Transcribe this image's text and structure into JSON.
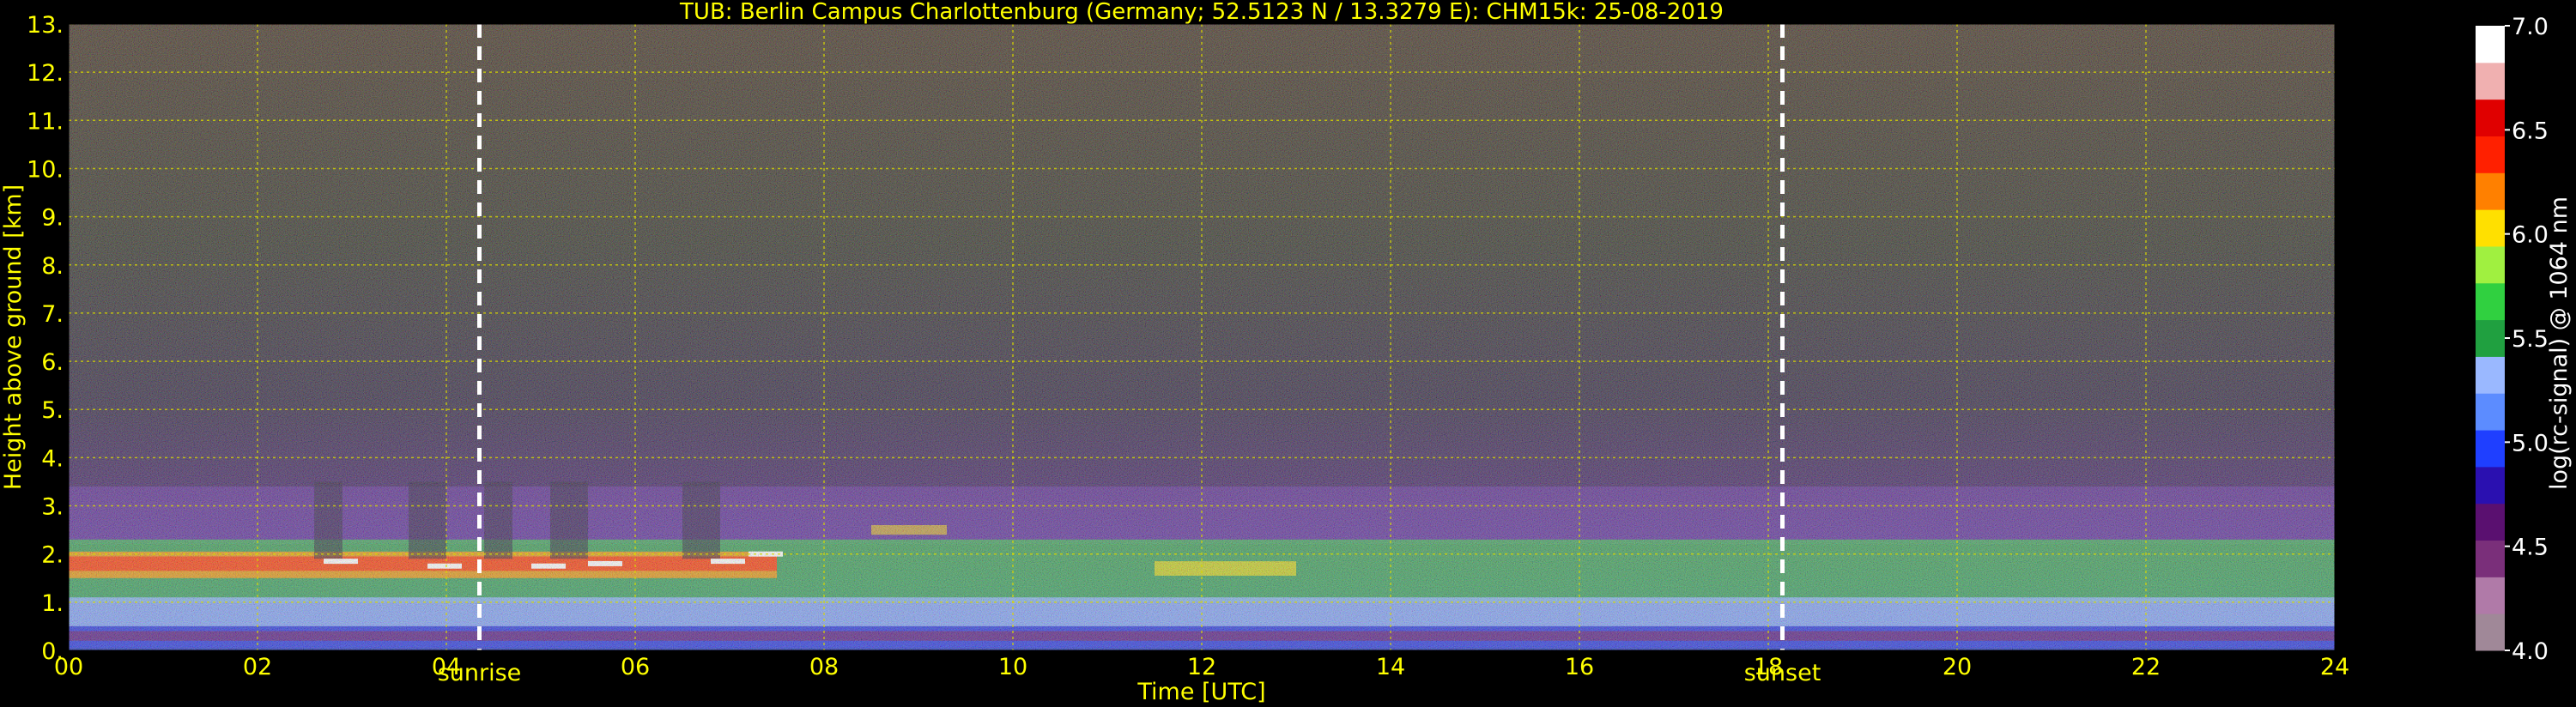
{
  "chart_data": {
    "type": "heatmap",
    "title": "TUB: Berlin Campus Charlottenburg (Germany; 52.5123 N / 13.3279 E):    CHM15k: 25-08-2019",
    "xlabel": "Time [UTC]",
    "ylabel": "Height above ground [km]",
    "xlim": [
      0,
      24
    ],
    "ylim": [
      0,
      13
    ],
    "x_ticks": [
      "00",
      "02",
      "04",
      "06",
      "08",
      "10",
      "12",
      "14",
      "16",
      "18",
      "20",
      "22",
      "24"
    ],
    "y_ticks": [
      "0.",
      "1.",
      "2.",
      "3.",
      "4.",
      "5.",
      "6.",
      "7.",
      "8.",
      "9.",
      "10.",
      "11.",
      "12.",
      "13."
    ],
    "grid": true,
    "colorbar": {
      "label": "log(rc-signal) @ 1064 nm",
      "range": [
        4.0,
        7.0
      ],
      "ticks": [
        "4.0",
        "4.5",
        "5.0",
        "5.5",
        "6.0",
        "6.5",
        "7.0"
      ]
    },
    "events": [
      {
        "name": "sunrise",
        "time_utc": 4.35
      },
      {
        "name": "sunset",
        "time_utc": 18.15
      }
    ],
    "layers": [
      {
        "feature": "mixing-layer top (strong signal)",
        "start": 0,
        "end": 7.5,
        "height_km": 1.8
      },
      {
        "feature": "aerosol layer",
        "start": 7.5,
        "end": 24,
        "height_km": 1.6
      },
      {
        "feature": "near-surface layer",
        "start": 0,
        "end": 24,
        "height_km": 0.4
      }
    ]
  },
  "colors": {
    "text": "#ffff00",
    "grid": "#d8d800",
    "background": "#000000",
    "event_line": "#ffffff",
    "colormap": [
      "#a08898",
      "#b07aa8",
      "#7a2f7a",
      "#5a1070",
      "#2a10b0",
      "#1f3fff",
      "#5c8cff",
      "#9ab8ff",
      "#20a040",
      "#30d040",
      "#a0f040",
      "#ffe000",
      "#ff8000",
      "#ff2000",
      "#e00000",
      "#f0b0b0",
      "#ffffff"
    ]
  }
}
